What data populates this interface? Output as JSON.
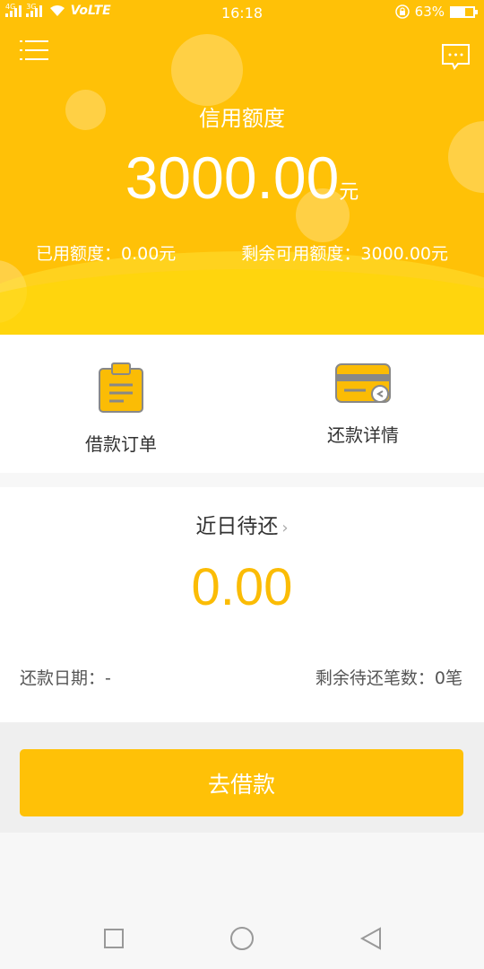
{
  "status_bar": {
    "signal_left": "4G",
    "signal_right": "3G",
    "network": "VoLTE",
    "time": "16:18",
    "battery_text": "63%",
    "battery_level": 0.63
  },
  "header": {
    "credit_title": "信用额度",
    "credit_amount": "3000.00",
    "credit_unit": "元",
    "used_text": "已用额度：0.00元",
    "remaining_text": "剩余可用额度：3000.00元"
  },
  "actions": {
    "order_label": "借款订单",
    "repay_label": "还款详情"
  },
  "recent": {
    "title": "近日待还",
    "amount": "0.00",
    "due_date": "还款日期：-",
    "remaining_count": "剩余待还笔数：0笔"
  },
  "borrow_button": "去借款",
  "colors": {
    "primary": "#ffc107",
    "amount": "#fbbc05"
  }
}
